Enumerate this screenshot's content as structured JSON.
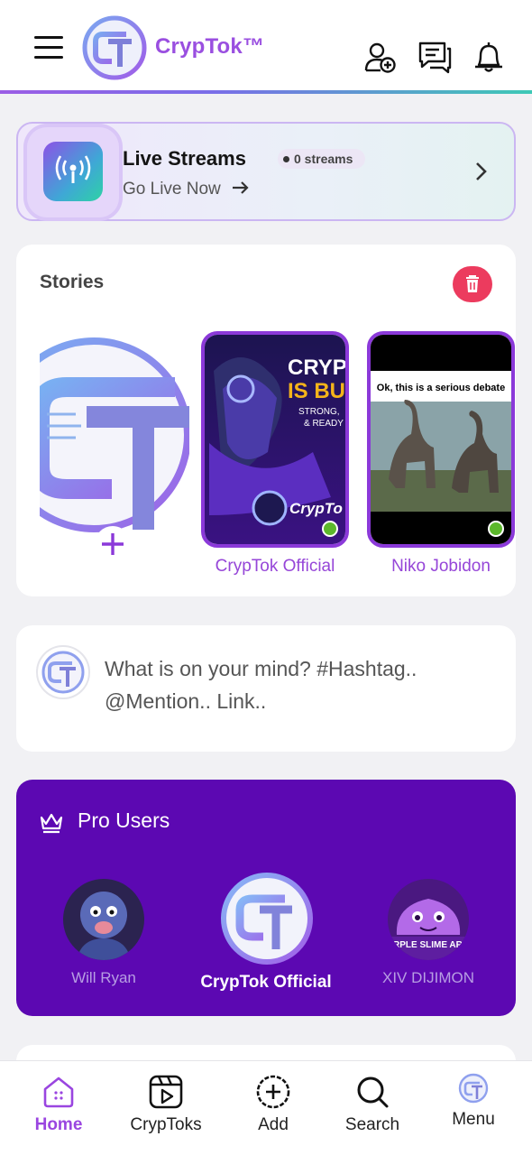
{
  "header": {
    "brand": "CrypTok™",
    "icons": [
      "menu-icon",
      "add-user-icon",
      "chat-icon",
      "bell-icon"
    ]
  },
  "live": {
    "title": "Live Streams",
    "count": "0 streams",
    "subtitle": "Go Live Now",
    "icon": "broadcast-icon"
  },
  "stories": {
    "title": "Stories",
    "items": [
      {
        "name": "CrypTok Official",
        "image_text": [
          "CRYP",
          "IS BU",
          "STRONG,",
          "& READY",
          "CrypTo"
        ]
      },
      {
        "name": "Niko Jobidon",
        "image_text": [
          "Ok, this is a serious debate"
        ]
      }
    ]
  },
  "composer": {
    "placeholder": "What is on your mind? #Hashtag.. @Mention.. Link.."
  },
  "pro_users": {
    "title": "Pro Users",
    "users": [
      {
        "name": "Will Ryan"
      },
      {
        "name": "CrypTok Official"
      },
      {
        "name": "XIV DIJIMON",
        "image_text": "PURPLE SLIME ARMY"
      }
    ]
  },
  "nav": {
    "items": [
      {
        "label": "Home",
        "icon": "home-icon",
        "active": true
      },
      {
        "label": "CrypToks",
        "icon": "video-icon"
      },
      {
        "label": "Add",
        "icon": "plus-circle-icon"
      },
      {
        "label": "Search",
        "icon": "search-icon"
      },
      {
        "label": "Menu",
        "icon": "avatar-icon"
      }
    ]
  },
  "colors": {
    "accent": "#9a45e0",
    "pro_bg": "#5c08b2",
    "trash": "#ec3b5e",
    "online": "#5cb82c"
  }
}
